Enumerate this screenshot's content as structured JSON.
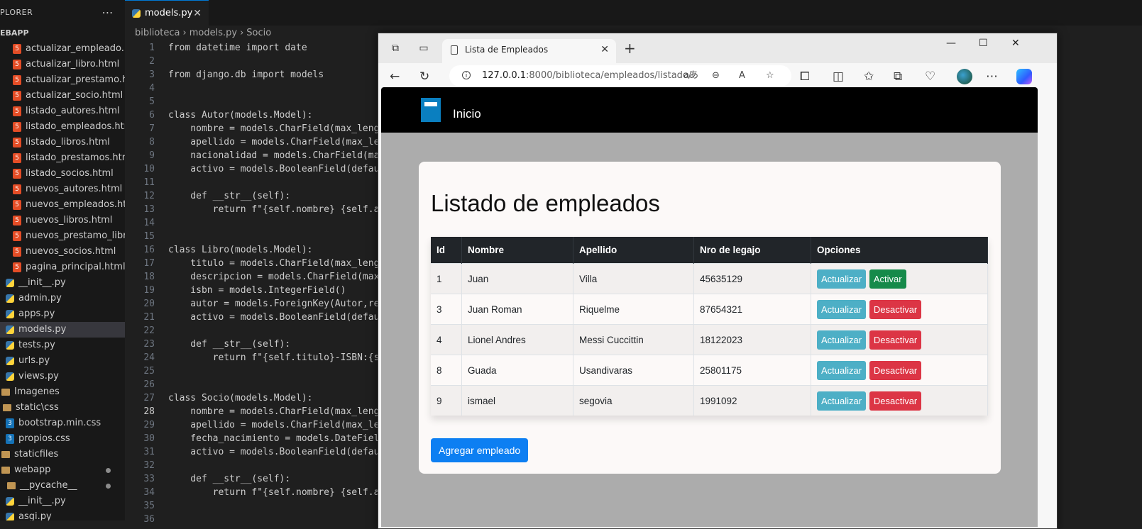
{
  "vscode": {
    "explorer_title": "PLORER",
    "project": "EBAPP",
    "tab_label": "models.py",
    "breadcrumb": [
      "biblioteca",
      "models.py",
      "Socio"
    ],
    "files": [
      {
        "name": "actualizar_empleado.h...",
        "type": "html"
      },
      {
        "name": "actualizar_libro.html",
        "type": "html"
      },
      {
        "name": "actualizar_prestamo.h...",
        "type": "html"
      },
      {
        "name": "actualizar_socio.html",
        "type": "html"
      },
      {
        "name": "listado_autores.html",
        "type": "html"
      },
      {
        "name": "listado_empleados.html",
        "type": "html"
      },
      {
        "name": "listado_libros.html",
        "type": "html"
      },
      {
        "name": "listado_prestamos.html",
        "type": "html"
      },
      {
        "name": "listado_socios.html",
        "type": "html"
      },
      {
        "name": "nuevos_autores.html",
        "type": "html"
      },
      {
        "name": "nuevos_empleados.ht...",
        "type": "html"
      },
      {
        "name": "nuevos_libros.html",
        "type": "html"
      },
      {
        "name": "nuevos_prestamo_libr...",
        "type": "html"
      },
      {
        "name": "nuevos_socios.html",
        "type": "html"
      },
      {
        "name": "pagina_principal.html",
        "type": "html"
      },
      {
        "name": "__init__.py",
        "type": "py"
      },
      {
        "name": "admin.py",
        "type": "py"
      },
      {
        "name": "apps.py",
        "type": "py"
      },
      {
        "name": "models.py",
        "type": "py"
      },
      {
        "name": "tests.py",
        "type": "py"
      },
      {
        "name": "urls.py",
        "type": "py"
      },
      {
        "name": "views.py",
        "type": "py"
      },
      {
        "name": "Imagenes",
        "type": "folder"
      },
      {
        "name": "static\\css",
        "type": "folder"
      },
      {
        "name": "bootstrap.min.css",
        "type": "css"
      },
      {
        "name": "propios.css",
        "type": "css"
      },
      {
        "name": "staticfiles",
        "type": "folder"
      },
      {
        "name": "webapp",
        "type": "folder"
      },
      {
        "name": "__pycache__",
        "type": "folder"
      },
      {
        "name": "__init__.py",
        "type": "py"
      },
      {
        "name": "asgi.py",
        "type": "py"
      }
    ],
    "code_lines": [
      "from datetime import date",
      "",
      "from django.db import models",
      "",
      "",
      "class Autor(models.Model):",
      "    nombre = models.CharField(max_leng",
      "    apellido = models.CharField(max_le",
      "    nacionalidad = models.CharField(ma",
      "    activo = models.BooleanField(defau",
      "",
      "    def __str__(self):",
      "        return f\"{self.nombre} {self.a",
      "",
      "",
      "class Libro(models.Model):",
      "    titulo = models.CharField(max_leng",
      "    descripcion = models.CharField(max",
      "    isbn = models.IntegerField()",
      "    autor = models.ForeignKey(Autor,re",
      "    activo = models.BooleanField(defau",
      "",
      "    def __str__(self):",
      "        return f\"{self.titulo}-ISBN:{s",
      "",
      "",
      "class Socio(models.Model):",
      "    nombre = models.CharField(max_leng",
      "    apellido = models.CharField(max_le",
      "    fecha_nacimiento = models.DateFiel",
      "    activo = models.BooleanField(defau",
      "",
      "    def __str__(self):",
      "        return f\"{self.nombre} {self.a",
      "",
      ""
    ],
    "current_line": 28
  },
  "browser": {
    "tab_title": "Lista de Empleados",
    "url_host": "127.0.0.1",
    "url_path": ":8000/biblioteca/empleados/listado/",
    "read_aloud_glyph": "aあ"
  },
  "page": {
    "nav_link": "Inicio",
    "title": "Listado de empleados",
    "columns": [
      "Id",
      "Nombre",
      "Apellido",
      "Nro de legajo",
      "Opciones"
    ],
    "rows": [
      {
        "id": "1",
        "nombre": "Juan",
        "apellido": "Villa",
        "legajo": "45635129",
        "btn1": "Actualizar",
        "btn2": "Activar"
      },
      {
        "id": "3",
        "nombre": "Juan Roman",
        "apellido": "Riquelme",
        "legajo": "87654321",
        "btn1": "Actualizar",
        "btn2": "Desactivar"
      },
      {
        "id": "4",
        "nombre": "Lionel Andres",
        "apellido": "Messi Cuccittin",
        "legajo": "18122023",
        "btn1": "Actualizar",
        "btn2": "Desactivar"
      },
      {
        "id": "8",
        "nombre": "Guada",
        "apellido": "Usandivaras",
        "legajo": "25801175",
        "btn1": "Actualizar",
        "btn2": "Desactivar"
      },
      {
        "id": "9",
        "nombre": "ismael",
        "apellido": "segovia",
        "legajo": "1991092",
        "btn1": "Actualizar",
        "btn2": "Desactivar"
      }
    ],
    "add_button": "Agregar empleado"
  },
  "colors": {
    "btn_update": "#4dafc6",
    "btn_activate": "#168a4a",
    "btn_deactivate": "#dc3545",
    "btn_primary": "#0d7ff2",
    "table_header": "#212529"
  }
}
